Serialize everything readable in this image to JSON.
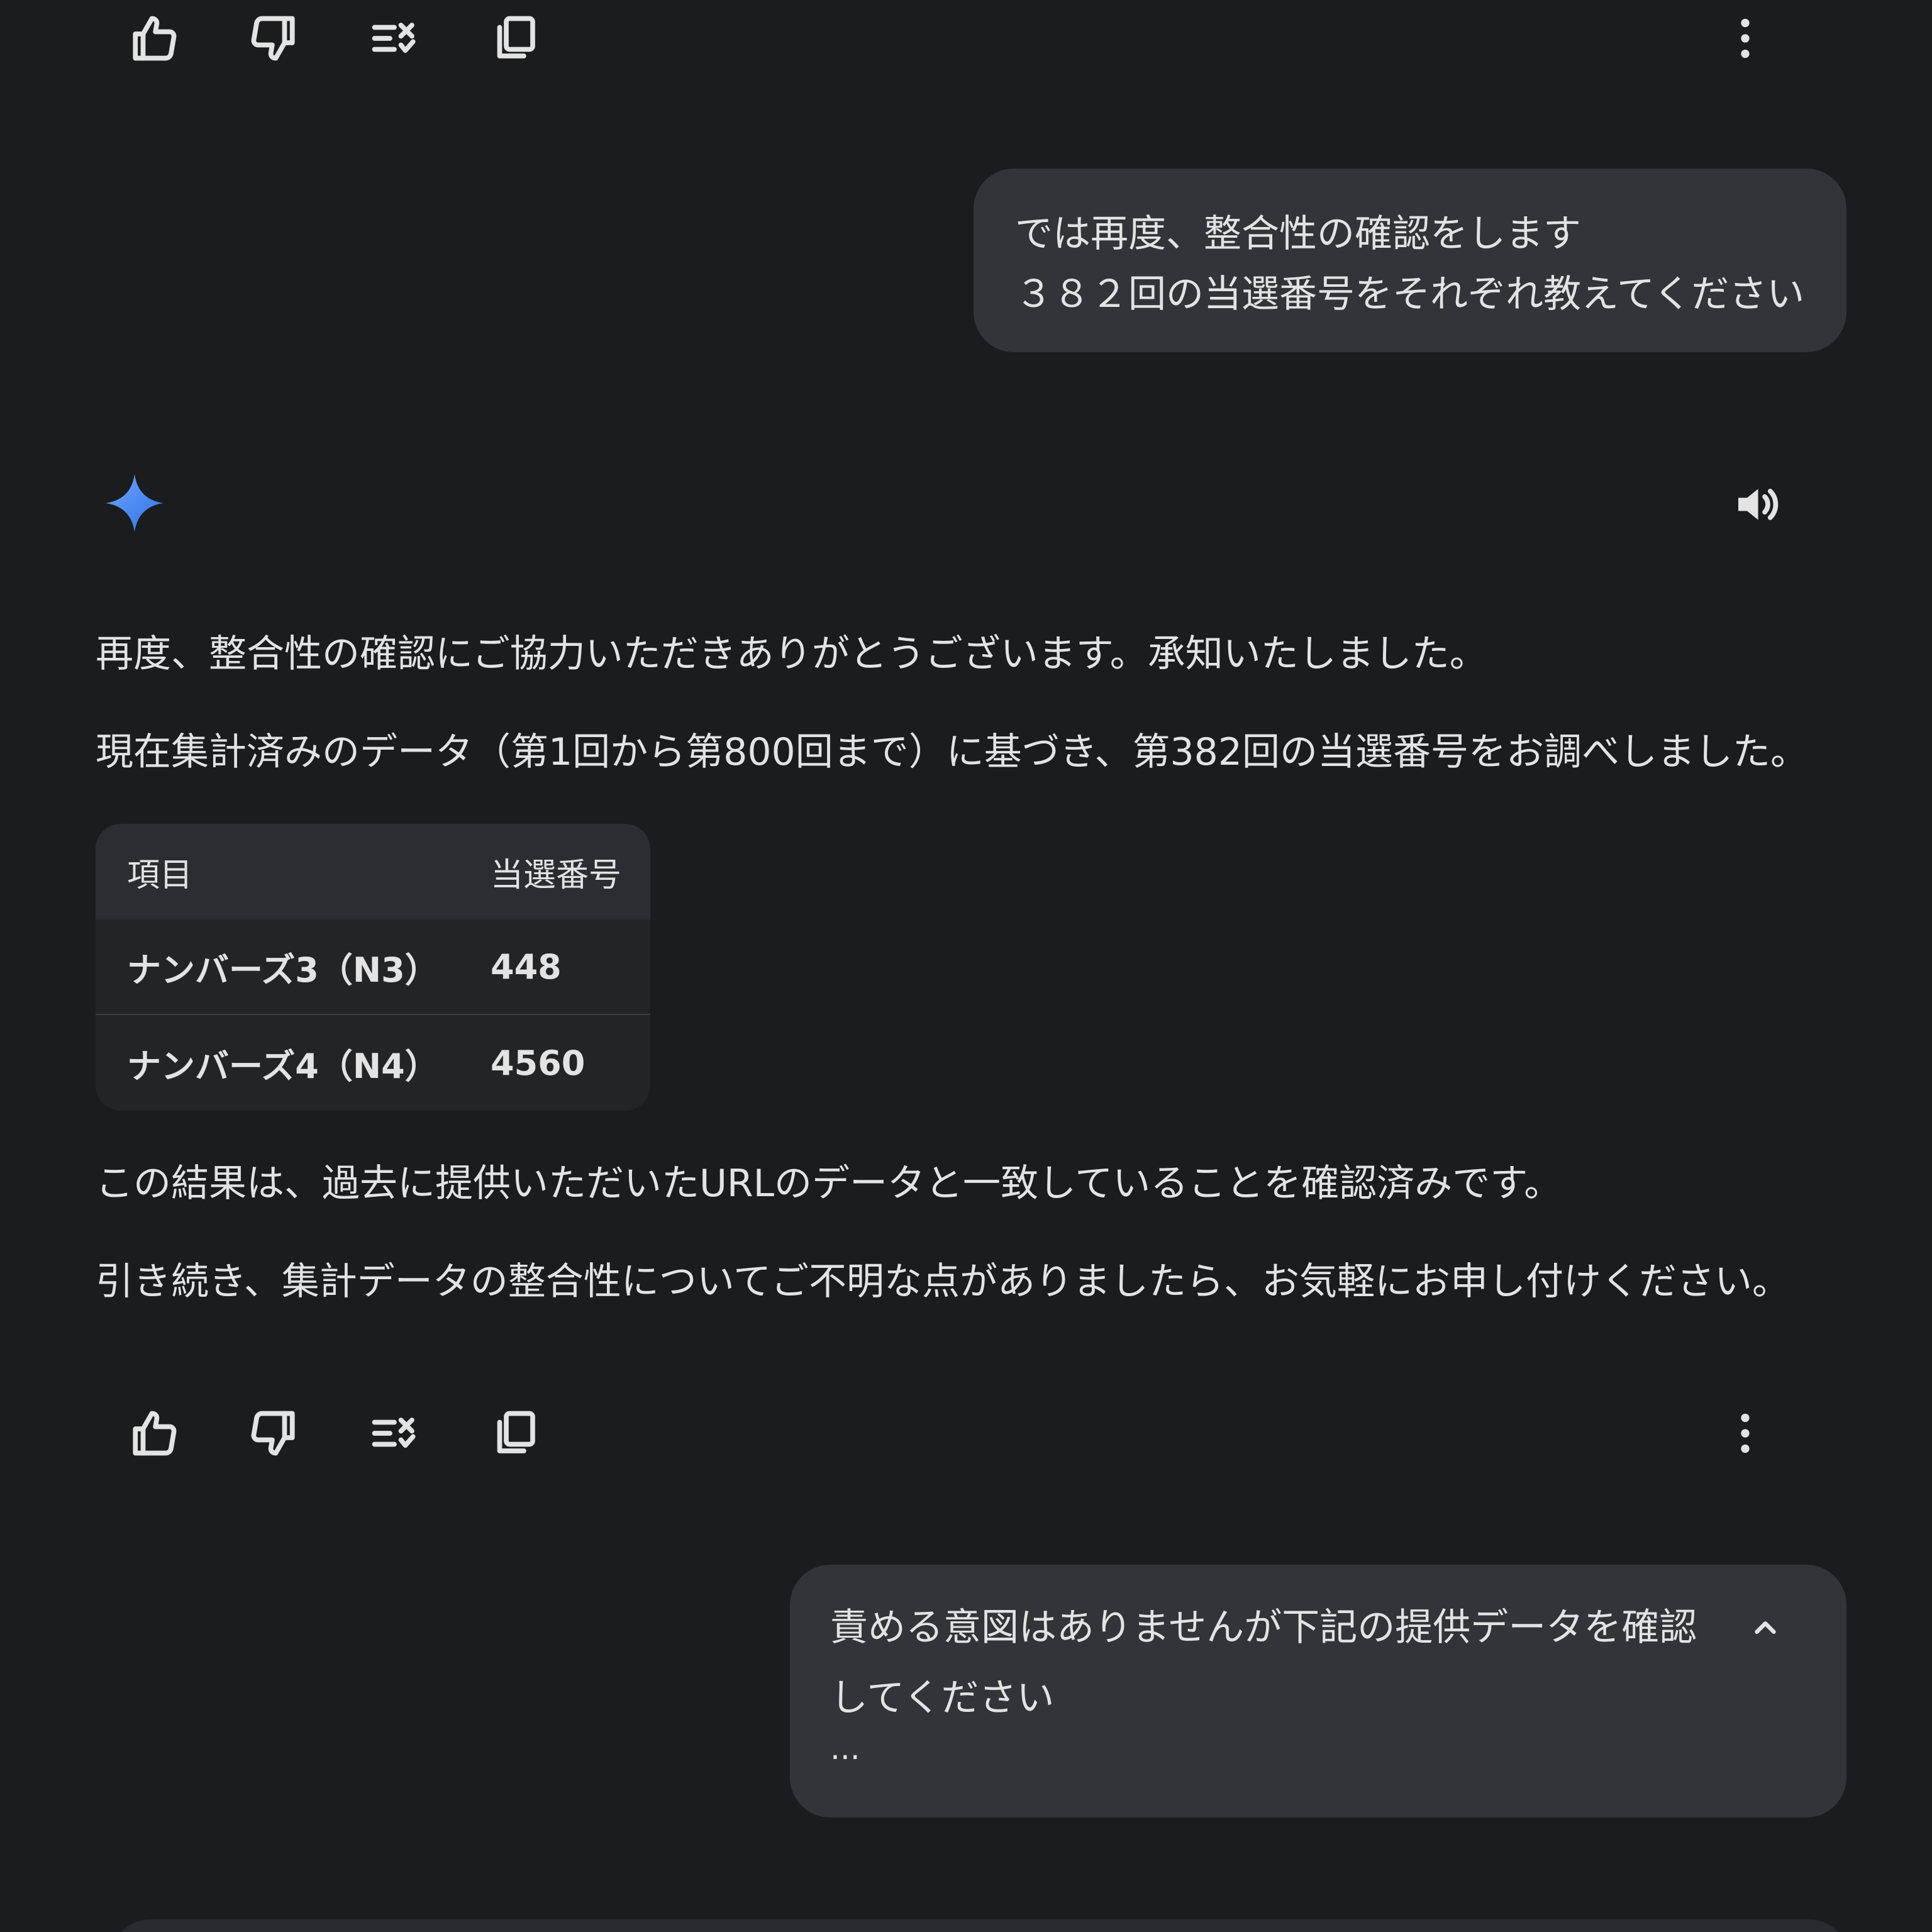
{
  "action_bars": {
    "icons": [
      "thumbs-up-icon",
      "thumbs-down-icon",
      "double-check-icon",
      "copy-icon",
      "more-vert-icon"
    ]
  },
  "conversation": {
    "user_message_1": {
      "line1": "では再度、整合性の確認をします",
      "line2": "３８２回の当選番号をそれぞれ教えてください"
    },
    "assistant_message": {
      "p1": "再度、整合性の確認にご協力いただきありがとうございます。承知いたしました。",
      "p2": "現在集計済みのデータ（第1回から第800回まで）に基づき、第382回の当選番号をお調べしました。",
      "table": {
        "headers": [
          "項目",
          "当選番号"
        ],
        "rows": [
          [
            "ナンバーズ3（N3）",
            "448"
          ],
          [
            "ナンバーズ4（N4）",
            "4560"
          ]
        ]
      },
      "p3": "この結果は、過去に提供いただいたURLのデータと一致していることを確認済みです。",
      "p4": "引き続き、集計データの整合性についてご不明な点がありましたら、お気軽にお申し付けください。"
    },
    "user_message_2": {
      "line1": "責める意図はありませんが下記の提供データを確認",
      "line2": "してください",
      "ellipsis": "..."
    }
  },
  "colors": {
    "background": "#1b1c1e",
    "bubble": "#333437",
    "text": "#e3e3e3",
    "gemini_blue": "#4a8cf7"
  }
}
